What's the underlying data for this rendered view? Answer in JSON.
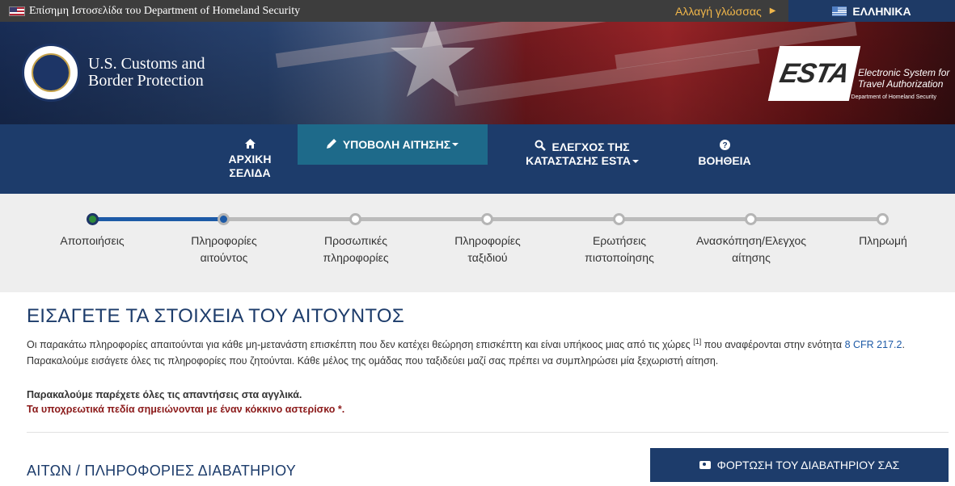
{
  "topbar": {
    "official_text": "Επίσημη Ιστοσελίδα του Department of Homeland Security",
    "change_language": "Αλλαγή γλώσσας",
    "current_language": "ΕΛΛΗΝΙΚΑ"
  },
  "banner": {
    "agency_line1": "U.S. Customs and",
    "agency_line2": "Border Protection",
    "esta_logo": "ESTA",
    "esta_caption_line1": "Electronic System for",
    "esta_caption_line2": "Travel Authorization",
    "esta_sub": "U.S. Department of Homeland Security"
  },
  "nav": {
    "home_line1": "ΑΡΧΙΚΗ",
    "home_line2": "ΣΕΛΙΔΑ",
    "apply": "ΥΠΟΒΟΛΗ ΑΙΤΗΣΗΣ",
    "status_line1": "ΕΛΕΓΧΟΣ ΤΗΣ",
    "status_line2": "ΚΑΤΑΣΤΑΣΗΣ ESTA",
    "help": "ΒΟΗΘΕΙΑ"
  },
  "progress": {
    "steps": [
      {
        "line1": "Αποποιήσεις",
        "line2": "",
        "state": "done"
      },
      {
        "line1": "Πληροφορίες",
        "line2": "αιτούντος",
        "state": "current"
      },
      {
        "line1": "Προσωπικές",
        "line2": "πληροφορίες",
        "state": "pending"
      },
      {
        "line1": "Πληροφορίες",
        "line2": "ταξιδιού",
        "state": "pending"
      },
      {
        "line1": "Ερωτήσεις",
        "line2": "πιστοποίησης",
        "state": "pending"
      },
      {
        "line1": "Ανασκόπηση/Ελεγχος",
        "line2": "αίτησης",
        "state": "pending"
      },
      {
        "line1": "Πληρωμή",
        "line2": "",
        "state": "pending"
      }
    ]
  },
  "content": {
    "title": "ΕΙΣΑΓΕΤΕ ΤΑ ΣΤΟΙΧΕΙΑ ΤΟΥ ΑΙΤΟΥΝΤΟΣ",
    "intro_part1": "Οι παρακάτω πληροφορίες απαιτούνται για κάθε μη-μετανάστη επισκέπτη που δεν κατέχει θεώρηση επισκέπτη και είναι υπήκοος μιας από τις χώρες ",
    "footnote": "[1]",
    "intro_part2": " που αναφέρονται στην ενότητα ",
    "intro_link": "8 CFR 217.2",
    "intro_part3": ". Παρακαλούμε εισάγετε όλες τις πληροφορίες που ζητούνται. Κάθε μέλος της ομάδας που ταξιδεύει μαζί σας πρέπει να συμπληρώσει μία ξεχωριστή αίτηση.",
    "english_note": "Παρακαλούμε παρέχετε όλες τις απαντήσεις στα αγγλικά.",
    "required_note": "Τα υποχρεωτικά πεδία σημειώνονται με έναν κόκκινο αστερίσκο *.",
    "section_title": "ΑΙΤΩΝ / ΠΛΗΡΟΦΟΡΙΕΣ ΔΙΑΒΑΤΗΡΙΟΥ",
    "upload_button": "ΦΟΡΤΩΣΗ ΤΟΥ ΔΙΑΒΑΤΗΡΙΟΥ ΣΑΣ"
  },
  "icons": {
    "home": "home-icon",
    "pencil": "pencil-icon",
    "search": "search-icon",
    "help": "question-circle-icon",
    "camera": "camera-icon"
  },
  "colors": {
    "nav_bg": "#1d3c6b",
    "nav_active": "#1e6a8a",
    "accent_link": "#1d5aa6",
    "required_red": "#8b1a1a",
    "language_gold": "#f0b64a"
  }
}
